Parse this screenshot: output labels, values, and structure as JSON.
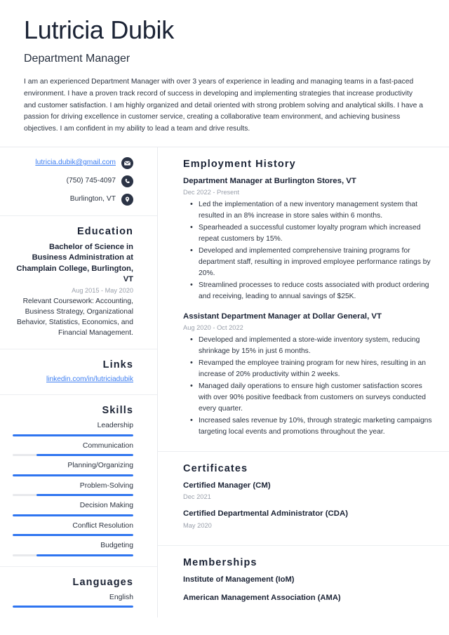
{
  "header": {
    "name": "Lutricia Dubik",
    "job_title": "Department Manager",
    "summary": "I am an experienced Department Manager with over 3 years of experience in leading and managing teams in a fast-paced environment. I have a proven track record of success in developing and implementing strategies that increase productivity and customer satisfaction. I am highly organized and detail oriented with strong problem solving and analytical skills. I have a passion for driving excellence in customer service, creating a collaborative team environment, and achieving business objectives. I am confident in my ability to lead a team and drive results."
  },
  "sidebar": {
    "contact": {
      "email": "lutricia.dubik@gmail.com",
      "email_icon": "envelope-icon",
      "phone": "(750) 745-4097",
      "phone_icon": "phone-icon",
      "location": "Burlington, VT",
      "location_icon": "location-pin-icon"
    },
    "education": {
      "heading": "Education",
      "degree": "Bachelor of Science in Business Administration at Champlain College, Burlington, VT",
      "date": "Aug 2015 - May 2020",
      "description": "Relevant Coursework: Accounting, Business Strategy, Organizational Behavior, Statistics, Economics, and Financial Management."
    },
    "links": {
      "heading": "Links",
      "items": [
        {
          "label": "linkedin.com/in/lutriciadubik"
        }
      ]
    },
    "skills": {
      "heading": "Skills",
      "items": [
        {
          "label": "Leadership",
          "level": 100
        },
        {
          "label": "Communication",
          "level": 80
        },
        {
          "label": "Planning/Organizing",
          "level": 100
        },
        {
          "label": "Problem-Solving",
          "level": 80
        },
        {
          "label": "Decision Making",
          "level": 100
        },
        {
          "label": "Conflict Resolution",
          "level": 100
        },
        {
          "label": "Budgeting",
          "level": 80
        }
      ]
    },
    "languages": {
      "heading": "Languages",
      "items": [
        {
          "label": "English",
          "level": 100
        }
      ]
    }
  },
  "main": {
    "employment": {
      "heading": "Employment History",
      "entries": [
        {
          "title": "Department Manager at Burlington Stores, VT",
          "date": "Dec 2022 - Present",
          "bullets": [
            "Led the implementation of a new inventory management system that resulted in an 8% increase in store sales within 6 months.",
            "Spearheaded a successful customer loyalty program which increased repeat customers by 15%.",
            "Developed and implemented comprehensive training programs for department staff, resulting in improved employee performance ratings by 20%.",
            "Streamlined processes to reduce costs associated with product ordering and receiving, leading to annual savings of $25K."
          ]
        },
        {
          "title": "Assistant Department Manager at Dollar General, VT",
          "date": "Aug 2020 - Oct 2022",
          "bullets": [
            "Developed and implemented a store-wide inventory system, reducing shrinkage by 15% in just 6 months.",
            "Revamped the employee training program for new hires, resulting in an increase of 20% productivity within 2 weeks.",
            "Managed daily operations to ensure high customer satisfaction scores with over 90% positive feedback from customers on surveys conducted every quarter.",
            "Increased sales revenue by 10%, through strategic marketing campaigns targeting local events and promotions throughout the year."
          ]
        }
      ]
    },
    "certificates": {
      "heading": "Certificates",
      "entries": [
        {
          "title": "Certified Manager (CM)",
          "date": "Dec 2021"
        },
        {
          "title": "Certified Departmental Administrator (CDA)",
          "date": "May 2020"
        }
      ]
    },
    "memberships": {
      "heading": "Memberships",
      "entries": [
        {
          "title": "Institute of Management (IoM)"
        },
        {
          "title": "American Management Association (AMA)"
        }
      ]
    }
  },
  "colors": {
    "accent_blue": "#2f75f0",
    "link_blue": "#3d7ef2",
    "ink": "#1b2335",
    "muted": "#9aa0ab",
    "icon_bg": "#2b3345",
    "rule": "#eceef1"
  }
}
